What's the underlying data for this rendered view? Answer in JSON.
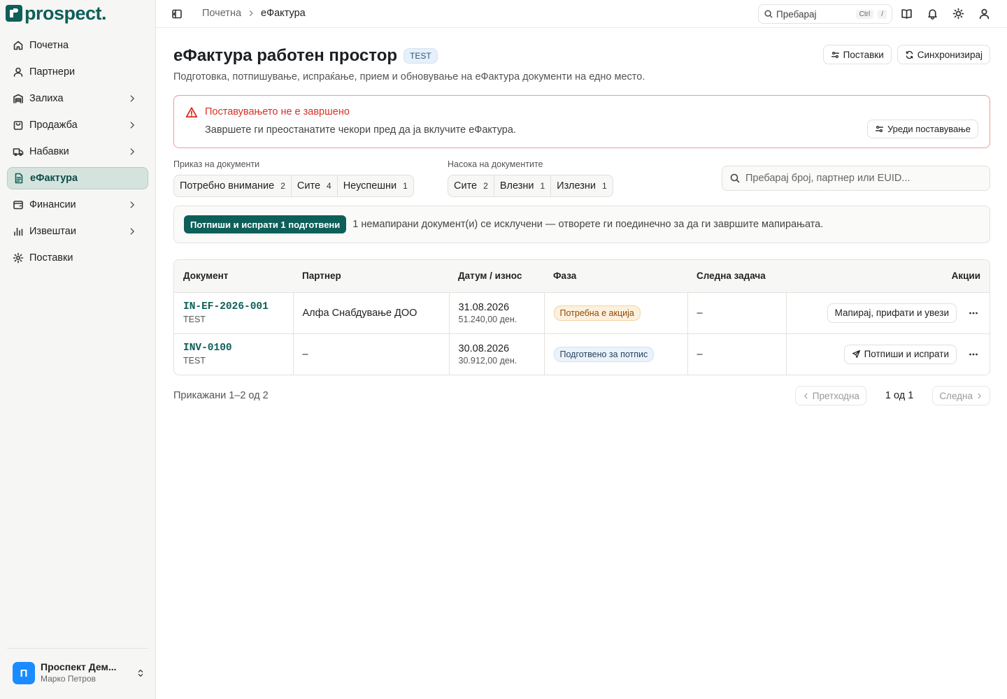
{
  "app": {
    "brand": "prospect."
  },
  "sidebar": {
    "items": [
      {
        "label": "Почетна",
        "icon": "home-icon"
      },
      {
        "label": "Партнери",
        "icon": "user-icon"
      },
      {
        "label": "Залиха",
        "icon": "warehouse-icon"
      },
      {
        "label": "Продажба",
        "icon": "shopping-bag-icon"
      },
      {
        "label": "Набавки",
        "icon": "truck-icon"
      },
      {
        "label": "еФактура",
        "icon": "document-icon"
      },
      {
        "label": "Финансии",
        "icon": "wallet-icon"
      },
      {
        "label": "Извештаи",
        "icon": "bar-chart-icon"
      },
      {
        "label": "Поставки",
        "icon": "gear-icon"
      }
    ],
    "active_index": 5,
    "user": {
      "initial": "П",
      "org": "Проспект Дем...",
      "name": "Марко Петров"
    }
  },
  "topbar": {
    "breadcrumb": [
      "Почетна",
      "еФактура"
    ],
    "search": {
      "label": "Пребарај",
      "kbd1": "Ctrl",
      "kbd2": "/"
    }
  },
  "page": {
    "title": "еФактура работен простор",
    "env_badge": "TEST",
    "subtitle": "Подготовка, потпишување, испраќање, прием и обновување на еФактура документи на едно место.",
    "settings_btn": "Поставки",
    "sync_btn": "Синхронизирај"
  },
  "alert": {
    "title": "Поставувањето не е завршено",
    "text": "Завршете ги преостанатите чекори пред да ја вклучите еФактура.",
    "button": "Уреди поставување"
  },
  "filters": {
    "view_label": "Приказ на документи",
    "view": [
      {
        "label": "Потребно внимание",
        "count": "2"
      },
      {
        "label": "Сите",
        "count": "4"
      },
      {
        "label": "Неуспешни",
        "count": "1"
      }
    ],
    "direction_label": "Насока на документите",
    "direction": [
      {
        "label": "Сите",
        "count": "2"
      },
      {
        "label": "Влезни",
        "count": "1"
      },
      {
        "label": "Излезни",
        "count": "1"
      }
    ],
    "search_placeholder": "Пребарај број, партнер или EUID..."
  },
  "bulk": {
    "button": "Потпиши и испрати 1 подготвени",
    "text": "1 немапирани документ(и) се исклучени — отворете ги поединечно за да ги завршите мапирањата."
  },
  "table": {
    "headers": {
      "doc": "Документ",
      "partner": "Партнер",
      "date": "Датум / износ",
      "phase": "Фаза",
      "next": "Следна задача",
      "actions": "Акции"
    },
    "rows": [
      {
        "doc": "IN-EF-2026-001",
        "env": "TEST",
        "partner": "Алфа Снабдување ДОО",
        "date": "31.08.2026",
        "amount": "51.240,00 ден.",
        "phase": "Потребна е акција",
        "next": "–",
        "action": "Мапирај, прифати и увези"
      },
      {
        "doc": "INV-0100",
        "env": "TEST",
        "partner": "–",
        "date": "30.08.2026",
        "amount": "30.912,00 ден.",
        "phase": "Подготвено за потпис",
        "next": "–",
        "action": "Потпиши и испрати"
      }
    ]
  },
  "pagination": {
    "shown": "Прикажани 1–2 од 2",
    "prev": "Претходна",
    "info": "1 од 1",
    "next": "Следна"
  },
  "colors": {
    "brand": "#0e5f59",
    "alert": "#d93025"
  }
}
